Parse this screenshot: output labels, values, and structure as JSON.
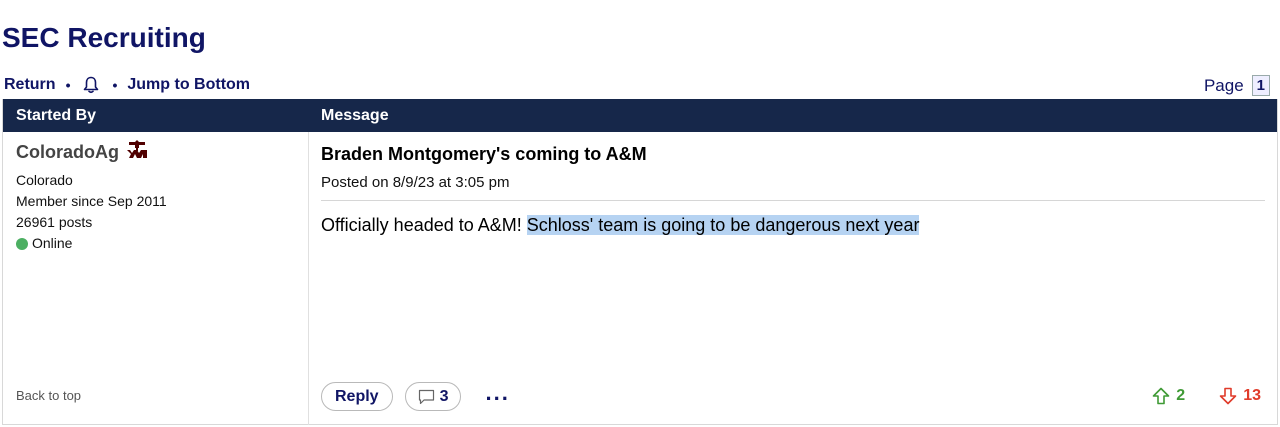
{
  "page": {
    "title": "SEC Recruiting"
  },
  "toolbar": {
    "return_label": "Return",
    "separator": "•",
    "jump_label": "Jump to Bottom"
  },
  "pager": {
    "label": "Page",
    "current": "1"
  },
  "table": {
    "col_started_by": "Started By",
    "col_message": "Message"
  },
  "author": {
    "username": "ColoradoAg",
    "location": "Colorado",
    "member_since": "Member since Sep 2011",
    "posts": "26961 posts",
    "status": "Online",
    "logo_text": "ATM",
    "back_to_top": "Back to top"
  },
  "post": {
    "title": "Braden Montgomery's coming to A&M",
    "posted": "Posted on 8/9/23 at 3:05 pm",
    "body_plain": "Officially headed to A&M! ",
    "body_highlighted": "Schloss' team is going to be dangerous next year",
    "reply_label": "Reply",
    "reply_count": "3",
    "more_label": "...",
    "upvotes": "2",
    "downvotes": "13"
  },
  "colors": {
    "brand_navy": "#101565",
    "header_bg": "#16274a",
    "online_green": "#4caf62",
    "upvote_green": "#3f9a35",
    "downvote_red": "#e03b2a",
    "highlight": "#b6d3f2",
    "aggie_maroon": "#500000"
  },
  "icons": {
    "bell": "bell-icon",
    "comment": "comment-icon",
    "upvote": "arrow-up-icon",
    "downvote": "arrow-down-icon",
    "team_logo": "texas-am-logo"
  }
}
